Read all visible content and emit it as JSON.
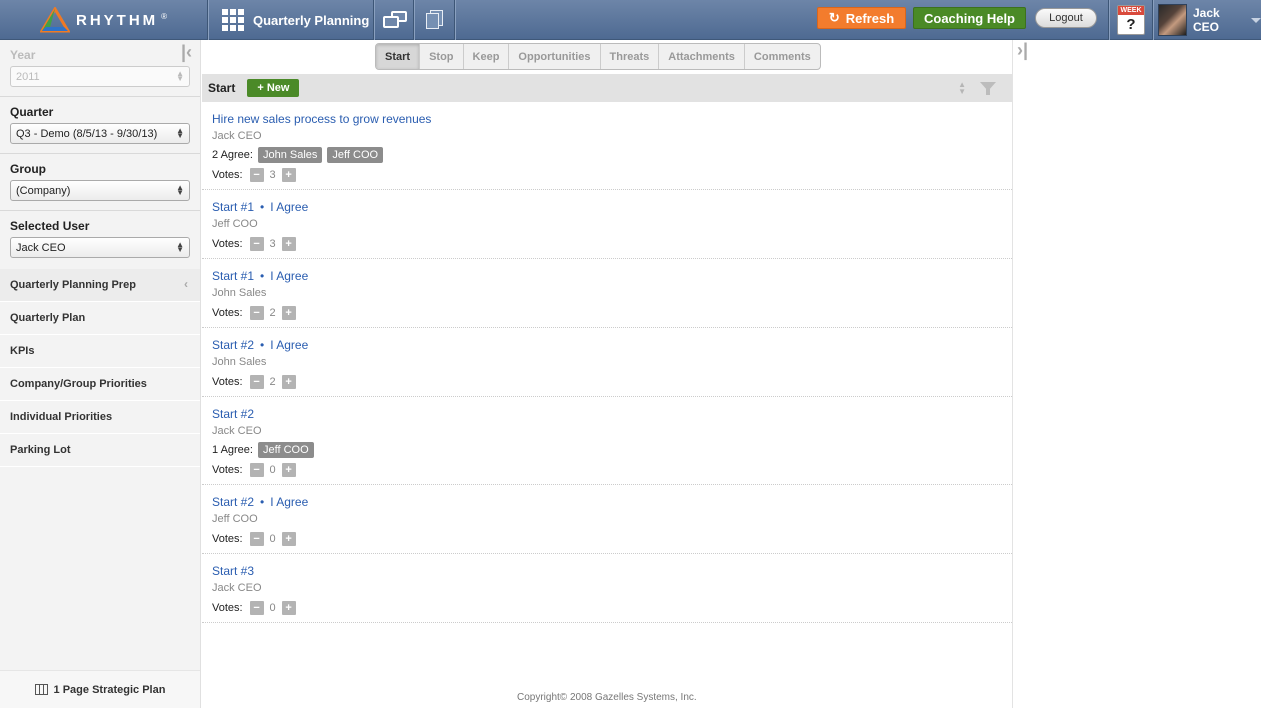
{
  "header": {
    "logo_text": "RHYTHM",
    "logo_reg": "®",
    "app_title": "Quarterly Planning",
    "refresh_label": "Refresh",
    "refresh_icon": "↻",
    "coaching_label": "Coaching Help",
    "logout_label": "Logout",
    "week_label": "WEEK",
    "week_help": "?",
    "user_name": "Jack CEO"
  },
  "sidebar": {
    "year_label": "Year",
    "year_value": "2011",
    "quarter_label": "Quarter",
    "quarter_value": "Q3 - Demo (8/5/13 - 9/30/13)",
    "group_label": "Group",
    "group_value": "(Company)",
    "user_label": "Selected User",
    "user_value": "Jack CEO",
    "nav": [
      {
        "label": "Quarterly Planning Prep"
      },
      {
        "label": "Quarterly Plan"
      },
      {
        "label": "KPIs"
      },
      {
        "label": "Company/Group Priorities"
      },
      {
        "label": "Individual Priorities"
      },
      {
        "label": "Parking Lot"
      }
    ],
    "footer_label": "1 Page Strategic Plan"
  },
  "tabs": [
    "Start",
    "Stop",
    "Keep",
    "Opportunities",
    "Threats",
    "Attachments",
    "Comments"
  ],
  "list": {
    "title": "Start",
    "new_label": "+ New",
    "votes_label": "Votes:",
    "minus": "−",
    "plus": "+",
    "agree_sep": "•",
    "items": [
      {
        "title": "Hire new sales process to grow revenues",
        "agree_link": "",
        "author": "Jack CEO",
        "agree_text": "2 Agree:",
        "chips": [
          "John Sales",
          "Jeff COO"
        ],
        "votes": "3"
      },
      {
        "title": "Start #1",
        "agree_link": "I Agree",
        "author": "Jeff COO",
        "agree_text": "",
        "chips": [],
        "votes": "3"
      },
      {
        "title": "Start #1",
        "agree_link": "I Agree",
        "author": "John Sales",
        "agree_text": "",
        "chips": [],
        "votes": "2"
      },
      {
        "title": "Start #2",
        "agree_link": "I Agree",
        "author": "John Sales",
        "agree_text": "",
        "chips": [],
        "votes": "2"
      },
      {
        "title": "Start #2",
        "agree_link": "",
        "author": "Jack CEO",
        "agree_text": "1 Agree:",
        "chips": [
          "Jeff COO"
        ],
        "votes": "0"
      },
      {
        "title": "Start #2",
        "agree_link": "I Agree",
        "author": "Jeff COO",
        "agree_text": "",
        "chips": [],
        "votes": "0"
      },
      {
        "title": "Start #3",
        "agree_link": "",
        "author": "Jack CEO",
        "agree_text": "",
        "chips": [],
        "votes": "0"
      }
    ]
  },
  "footer": {
    "copyright": "Copyright© 2008 Gazelles Systems, Inc."
  },
  "colors": {
    "topbar": "#5b7599",
    "refresh": "#f37c2d",
    "coaching": "#4a8a26",
    "link": "#2a5db0",
    "chip": "#8c8c8c"
  }
}
